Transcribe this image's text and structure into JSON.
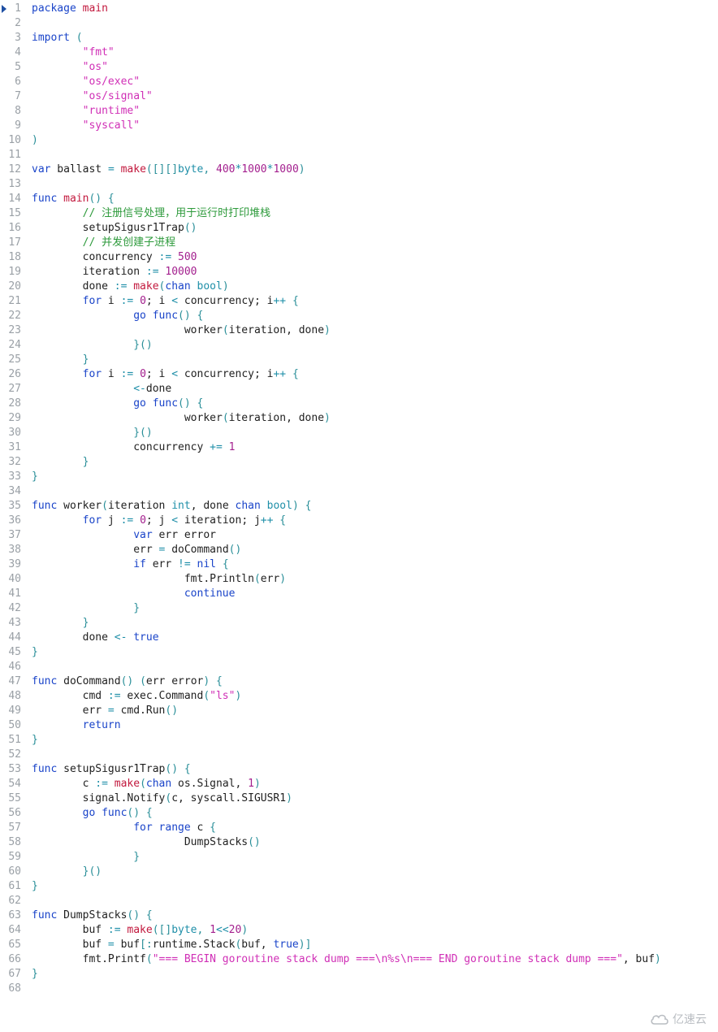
{
  "editor": {
    "language": "go",
    "current_line": 1,
    "lines": [
      [
        [
          "kw",
          "package"
        ],
        [
          "t",
          " "
        ],
        [
          "fn",
          "main"
        ]
      ],
      [],
      [
        [
          "kw",
          "import"
        ],
        [
          "t",
          " "
        ],
        [
          "brace",
          "("
        ]
      ],
      [
        [
          "t",
          "        "
        ],
        [
          "str",
          "\"fmt\""
        ]
      ],
      [
        [
          "t",
          "        "
        ],
        [
          "str",
          "\"os\""
        ]
      ],
      [
        [
          "t",
          "        "
        ],
        [
          "str",
          "\"os/exec\""
        ]
      ],
      [
        [
          "t",
          "        "
        ],
        [
          "str",
          "\"os/signal\""
        ]
      ],
      [
        [
          "t",
          "        "
        ],
        [
          "str",
          "\"runtime\""
        ]
      ],
      [
        [
          "t",
          "        "
        ],
        [
          "str",
          "\"syscall\""
        ]
      ],
      [
        [
          "brace",
          ")"
        ]
      ],
      [],
      [
        [
          "kw",
          "var"
        ],
        [
          "t",
          " ballast "
        ],
        [
          "op",
          "="
        ],
        [
          "t",
          " "
        ],
        [
          "fn",
          "make"
        ],
        [
          "brace",
          "([][]"
        ],
        [
          "ty",
          "byte"
        ],
        [
          "brace",
          ","
        ],
        [
          "t",
          " "
        ],
        [
          "num",
          "400"
        ],
        [
          "op",
          "*"
        ],
        [
          "num",
          "1000"
        ],
        [
          "op",
          "*"
        ],
        [
          "num",
          "1000"
        ],
        [
          "brace",
          ")"
        ]
      ],
      [],
      [
        [
          "kw",
          "func"
        ],
        [
          "t",
          " "
        ],
        [
          "fn",
          "main"
        ],
        [
          "brace",
          "() {"
        ]
      ],
      [
        [
          "t",
          "        "
        ],
        [
          "cmt",
          "// 注册信号处理，用于运行时打印堆栈"
        ]
      ],
      [
        [
          "t",
          "        setupSigusr1Trap"
        ],
        [
          "brace",
          "()"
        ]
      ],
      [
        [
          "t",
          "        "
        ],
        [
          "cmt",
          "// 并发创建子进程"
        ]
      ],
      [
        [
          "t",
          "        concurrency "
        ],
        [
          "op",
          ":="
        ],
        [
          "t",
          " "
        ],
        [
          "num",
          "500"
        ]
      ],
      [
        [
          "t",
          "        iteration "
        ],
        [
          "op",
          ":="
        ],
        [
          "t",
          " "
        ],
        [
          "num",
          "10000"
        ]
      ],
      [
        [
          "t",
          "        done "
        ],
        [
          "op",
          ":="
        ],
        [
          "t",
          " "
        ],
        [
          "fn",
          "make"
        ],
        [
          "brace",
          "("
        ],
        [
          "kw",
          "chan"
        ],
        [
          "t",
          " "
        ],
        [
          "ty",
          "bool"
        ],
        [
          "brace",
          ")"
        ]
      ],
      [
        [
          "t",
          "        "
        ],
        [
          "kw",
          "for"
        ],
        [
          "t",
          " i "
        ],
        [
          "op",
          ":="
        ],
        [
          "t",
          " "
        ],
        [
          "num",
          "0"
        ],
        [
          "t",
          "; i "
        ],
        [
          "op",
          "<"
        ],
        [
          "t",
          " concurrency; i"
        ],
        [
          "op",
          "++"
        ],
        [
          "t",
          " "
        ],
        [
          "brace",
          "{"
        ]
      ],
      [
        [
          "t",
          "                "
        ],
        [
          "kw",
          "go"
        ],
        [
          "t",
          " "
        ],
        [
          "kw",
          "func"
        ],
        [
          "brace",
          "() {"
        ]
      ],
      [
        [
          "t",
          "                        worker"
        ],
        [
          "brace",
          "("
        ],
        [
          "t",
          "iteration, done"
        ],
        [
          "brace",
          ")"
        ]
      ],
      [
        [
          "t",
          "                "
        ],
        [
          "brace",
          "}()"
        ]
      ],
      [
        [
          "t",
          "        "
        ],
        [
          "brace",
          "}"
        ]
      ],
      [
        [
          "t",
          "        "
        ],
        [
          "kw",
          "for"
        ],
        [
          "t",
          " i "
        ],
        [
          "op",
          ":="
        ],
        [
          "t",
          " "
        ],
        [
          "num",
          "0"
        ],
        [
          "t",
          "; i "
        ],
        [
          "op",
          "<"
        ],
        [
          "t",
          " concurrency; i"
        ],
        [
          "op",
          "++"
        ],
        [
          "t",
          " "
        ],
        [
          "brace",
          "{"
        ]
      ],
      [
        [
          "t",
          "                "
        ],
        [
          "op",
          "<-"
        ],
        [
          "t",
          "done"
        ]
      ],
      [
        [
          "t",
          "                "
        ],
        [
          "kw",
          "go"
        ],
        [
          "t",
          " "
        ],
        [
          "kw",
          "func"
        ],
        [
          "brace",
          "() {"
        ]
      ],
      [
        [
          "t",
          "                        worker"
        ],
        [
          "brace",
          "("
        ],
        [
          "t",
          "iteration, done"
        ],
        [
          "brace",
          ")"
        ]
      ],
      [
        [
          "t",
          "                "
        ],
        [
          "brace",
          "}()"
        ]
      ],
      [
        [
          "t",
          "                concurrency "
        ],
        [
          "op",
          "+="
        ],
        [
          "t",
          " "
        ],
        [
          "num",
          "1"
        ]
      ],
      [
        [
          "t",
          "        "
        ],
        [
          "brace",
          "}"
        ]
      ],
      [
        [
          "brace",
          "}"
        ]
      ],
      [],
      [
        [
          "kw",
          "func"
        ],
        [
          "t",
          " worker"
        ],
        [
          "brace",
          "("
        ],
        [
          "t",
          "iteration "
        ],
        [
          "ty",
          "int"
        ],
        [
          "t",
          ", done "
        ],
        [
          "kw",
          "chan"
        ],
        [
          "t",
          " "
        ],
        [
          "ty",
          "bool"
        ],
        [
          "brace",
          ") {"
        ]
      ],
      [
        [
          "t",
          "        "
        ],
        [
          "kw",
          "for"
        ],
        [
          "t",
          " j "
        ],
        [
          "op",
          ":="
        ],
        [
          "t",
          " "
        ],
        [
          "num",
          "0"
        ],
        [
          "t",
          "; j "
        ],
        [
          "op",
          "<"
        ],
        [
          "t",
          " iteration; j"
        ],
        [
          "op",
          "++"
        ],
        [
          "t",
          " "
        ],
        [
          "brace",
          "{"
        ]
      ],
      [
        [
          "t",
          "                "
        ],
        [
          "kw",
          "var"
        ],
        [
          "t",
          " err error"
        ]
      ],
      [
        [
          "t",
          "                err "
        ],
        [
          "op",
          "="
        ],
        [
          "t",
          " doCommand"
        ],
        [
          "brace",
          "()"
        ]
      ],
      [
        [
          "t",
          "                "
        ],
        [
          "kw",
          "if"
        ],
        [
          "t",
          " err "
        ],
        [
          "op",
          "!="
        ],
        [
          "t",
          " "
        ],
        [
          "kw",
          "nil"
        ],
        [
          "t",
          " "
        ],
        [
          "brace",
          "{"
        ]
      ],
      [
        [
          "t",
          "                        fmt.Println"
        ],
        [
          "brace",
          "("
        ],
        [
          "t",
          "err"
        ],
        [
          "brace",
          ")"
        ]
      ],
      [
        [
          "t",
          "                        "
        ],
        [
          "kw",
          "continue"
        ]
      ],
      [
        [
          "t",
          "                "
        ],
        [
          "brace",
          "}"
        ]
      ],
      [
        [
          "t",
          "        "
        ],
        [
          "brace",
          "}"
        ]
      ],
      [
        [
          "t",
          "        done "
        ],
        [
          "op",
          "<-"
        ],
        [
          "t",
          " "
        ],
        [
          "kw",
          "true"
        ]
      ],
      [
        [
          "brace",
          "}"
        ]
      ],
      [],
      [
        [
          "kw",
          "func"
        ],
        [
          "t",
          " doCommand"
        ],
        [
          "brace",
          "()"
        ],
        [
          "t",
          " "
        ],
        [
          "brace",
          "("
        ],
        [
          "t",
          "err error"
        ],
        [
          "brace",
          ")"
        ],
        [
          "t",
          " "
        ],
        [
          "brace",
          "{"
        ]
      ],
      [
        [
          "t",
          "        cmd "
        ],
        [
          "op",
          ":="
        ],
        [
          "t",
          " exec.Command"
        ],
        [
          "brace",
          "("
        ],
        [
          "str",
          "\"ls\""
        ],
        [
          "brace",
          ")"
        ]
      ],
      [
        [
          "t",
          "        err "
        ],
        [
          "op",
          "="
        ],
        [
          "t",
          " cmd.Run"
        ],
        [
          "brace",
          "()"
        ]
      ],
      [
        [
          "t",
          "        "
        ],
        [
          "kw",
          "return"
        ]
      ],
      [
        [
          "brace",
          "}"
        ]
      ],
      [],
      [
        [
          "kw",
          "func"
        ],
        [
          "t",
          " setupSigusr1Trap"
        ],
        [
          "brace",
          "() {"
        ]
      ],
      [
        [
          "t",
          "        c "
        ],
        [
          "op",
          ":="
        ],
        [
          "t",
          " "
        ],
        [
          "fn",
          "make"
        ],
        [
          "brace",
          "("
        ],
        [
          "kw",
          "chan"
        ],
        [
          "t",
          " os.Signal, "
        ],
        [
          "num",
          "1"
        ],
        [
          "brace",
          ")"
        ]
      ],
      [
        [
          "t",
          "        signal.Notify"
        ],
        [
          "brace",
          "("
        ],
        [
          "t",
          "c, syscall.SIGUSR1"
        ],
        [
          "brace",
          ")"
        ]
      ],
      [
        [
          "t",
          "        "
        ],
        [
          "kw",
          "go"
        ],
        [
          "t",
          " "
        ],
        [
          "kw",
          "func"
        ],
        [
          "brace",
          "() {"
        ]
      ],
      [
        [
          "t",
          "                "
        ],
        [
          "kw",
          "for"
        ],
        [
          "t",
          " "
        ],
        [
          "kw",
          "range"
        ],
        [
          "t",
          " c "
        ],
        [
          "brace",
          "{"
        ]
      ],
      [
        [
          "t",
          "                        DumpStacks"
        ],
        [
          "brace",
          "()"
        ]
      ],
      [
        [
          "t",
          "                "
        ],
        [
          "brace",
          "}"
        ]
      ],
      [
        [
          "t",
          "        "
        ],
        [
          "brace",
          "}()"
        ]
      ],
      [
        [
          "brace",
          "}"
        ]
      ],
      [],
      [
        [
          "kw",
          "func"
        ],
        [
          "t",
          " DumpStacks"
        ],
        [
          "brace",
          "() {"
        ]
      ],
      [
        [
          "t",
          "        buf "
        ],
        [
          "op",
          ":="
        ],
        [
          "t",
          " "
        ],
        [
          "fn",
          "make"
        ],
        [
          "brace",
          "([]"
        ],
        [
          "ty",
          "byte"
        ],
        [
          "brace",
          ","
        ],
        [
          "t",
          " "
        ],
        [
          "num",
          "1"
        ],
        [
          "op",
          "<<"
        ],
        [
          "num",
          "20"
        ],
        [
          "brace",
          ")"
        ]
      ],
      [
        [
          "t",
          "        buf "
        ],
        [
          "op",
          "="
        ],
        [
          "t",
          " buf"
        ],
        [
          "brace",
          "[:"
        ],
        [
          "t",
          "runtime.Stack"
        ],
        [
          "brace",
          "("
        ],
        [
          "t",
          "buf, "
        ],
        [
          "kw",
          "true"
        ],
        [
          "brace",
          ")]"
        ]
      ],
      [
        [
          "t",
          "        fmt.Printf"
        ],
        [
          "brace",
          "("
        ],
        [
          "str",
          "\"=== BEGIN goroutine stack dump ===\\n%s\\n=== END goroutine stack dump ===\""
        ],
        [
          "t",
          ", buf"
        ],
        [
          "brace",
          ")"
        ]
      ],
      [
        [
          "brace",
          "}"
        ]
      ],
      []
    ]
  },
  "watermark": {
    "text": "亿速云",
    "icon": "cloud-logo-icon"
  }
}
